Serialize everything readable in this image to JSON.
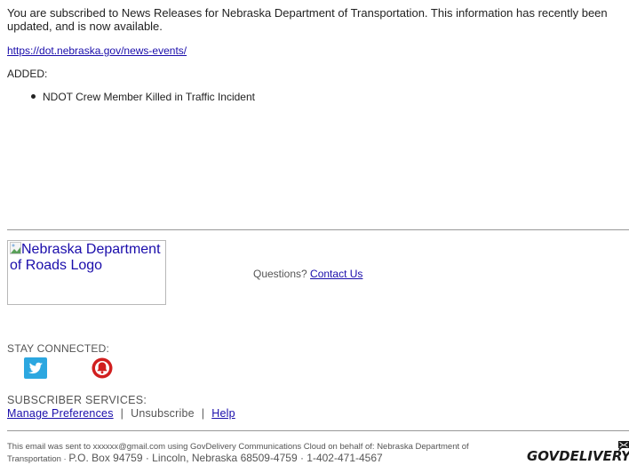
{
  "intro": {
    "text": "You are subscribed to News Releases for Nebraska Department of Transportation. This information has recently been updated, and is now available."
  },
  "link": {
    "text": "https://dot.nebraska.gov/news-events/"
  },
  "added_label": "ADDED:",
  "items": [
    {
      "label": "NDOT Crew Member Killed in Traffic Incident"
    }
  ],
  "logo": {
    "alt": "Nebraska Department of Roads Logo"
  },
  "questions": {
    "prefix": "Questions?",
    "contact_label": "Contact Us"
  },
  "stay_connected": {
    "label": "STAY CONNECTED:",
    "icons": [
      {
        "name": "twitter-icon",
        "color": "#2ca7e0"
      },
      {
        "name": "bell-alert-icon",
        "color": "#d11f1f"
      }
    ]
  },
  "subscriber_services": {
    "label": "SUBSCRIBER SERVICES:",
    "manage_label": "Manage Preferences",
    "separator": "|",
    "unsubscribe_label": "Unsubscribe",
    "help_label": "Help"
  },
  "footer": {
    "text_small": "This email was sent to xxxxxx@gmail.com using GovDelivery Communications Cloud on behalf of: Nebraska Department of Transportation · ",
    "text_large": "P.O. Box 94759 · Lincoln, Nebraska 68509-4759 · 1-402-471-4567",
    "brand": "GOVDELIVERY"
  }
}
